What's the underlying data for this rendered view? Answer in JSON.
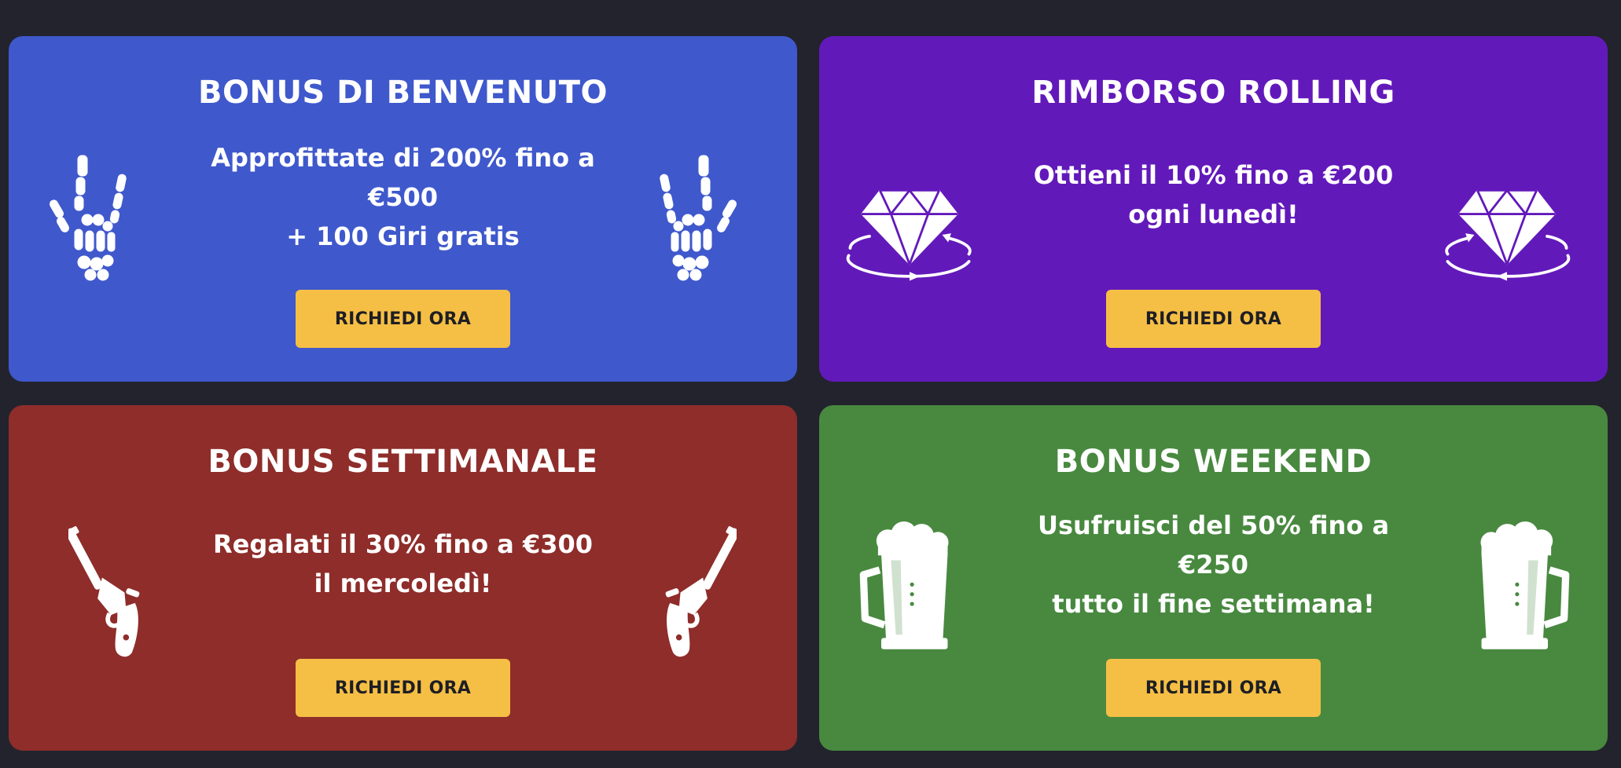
{
  "cards": [
    {
      "title": "BONUS DI BENVENUTO",
      "lines": [
        "Approfittate di 200% fino a",
        "€500",
        "+ 100 Giri gratis"
      ],
      "button": "RICHIEDI ORA",
      "color": "#3f58cc",
      "icon": "skeleton-hand-icon"
    },
    {
      "title": "RIMBORSO ROLLING",
      "lines": [
        "Ottieni il 10% fino a €200",
        "ogni lunedì!"
      ],
      "button": "RICHIEDI ORA",
      "color": "#6219ba",
      "icon": "diamond-icon"
    },
    {
      "title": "BONUS SETTIMANALE",
      "lines": [
        "Regalati il 30% fino a €300",
        "il mercoledì!"
      ],
      "button": "RICHIEDI ORA",
      "color": "#8e2d2a",
      "icon": "revolver-icon"
    },
    {
      "title": "BONUS WEEKEND",
      "lines": [
        "Usufruisci del 50% fino a",
        "€250",
        "tutto il fine settimana!"
      ],
      "button": "RICHIEDI ORA",
      "color": "#48893f",
      "icon": "beer-mug-icon"
    }
  ],
  "colors": {
    "page_background": "#22232d",
    "button_background": "#f5bf45",
    "button_text": "#1e1e24"
  }
}
